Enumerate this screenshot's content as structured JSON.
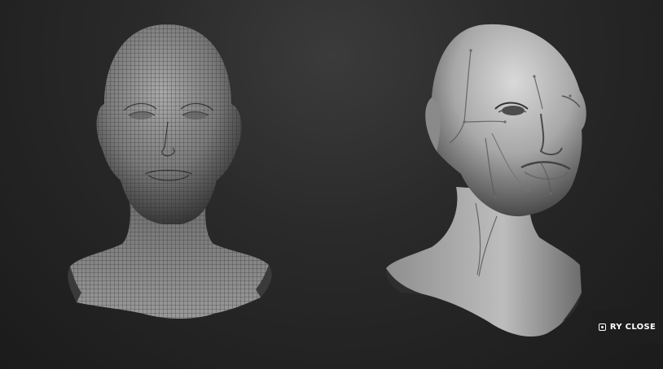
{
  "close_badge": {
    "label": "RY CLOSE",
    "icon": "camera-icon"
  },
  "models": [
    {
      "name": "wireframe-head",
      "style": "quad-mesh wireframe"
    },
    {
      "name": "sculpted-head",
      "style": "smooth sculpt with surface guide lines"
    }
  ],
  "colors": {
    "background_top": "#3b3b3b",
    "background_bottom": "#1b1b1b",
    "badge_bg": "#1e1e1e",
    "badge_text": "#ffffff"
  }
}
